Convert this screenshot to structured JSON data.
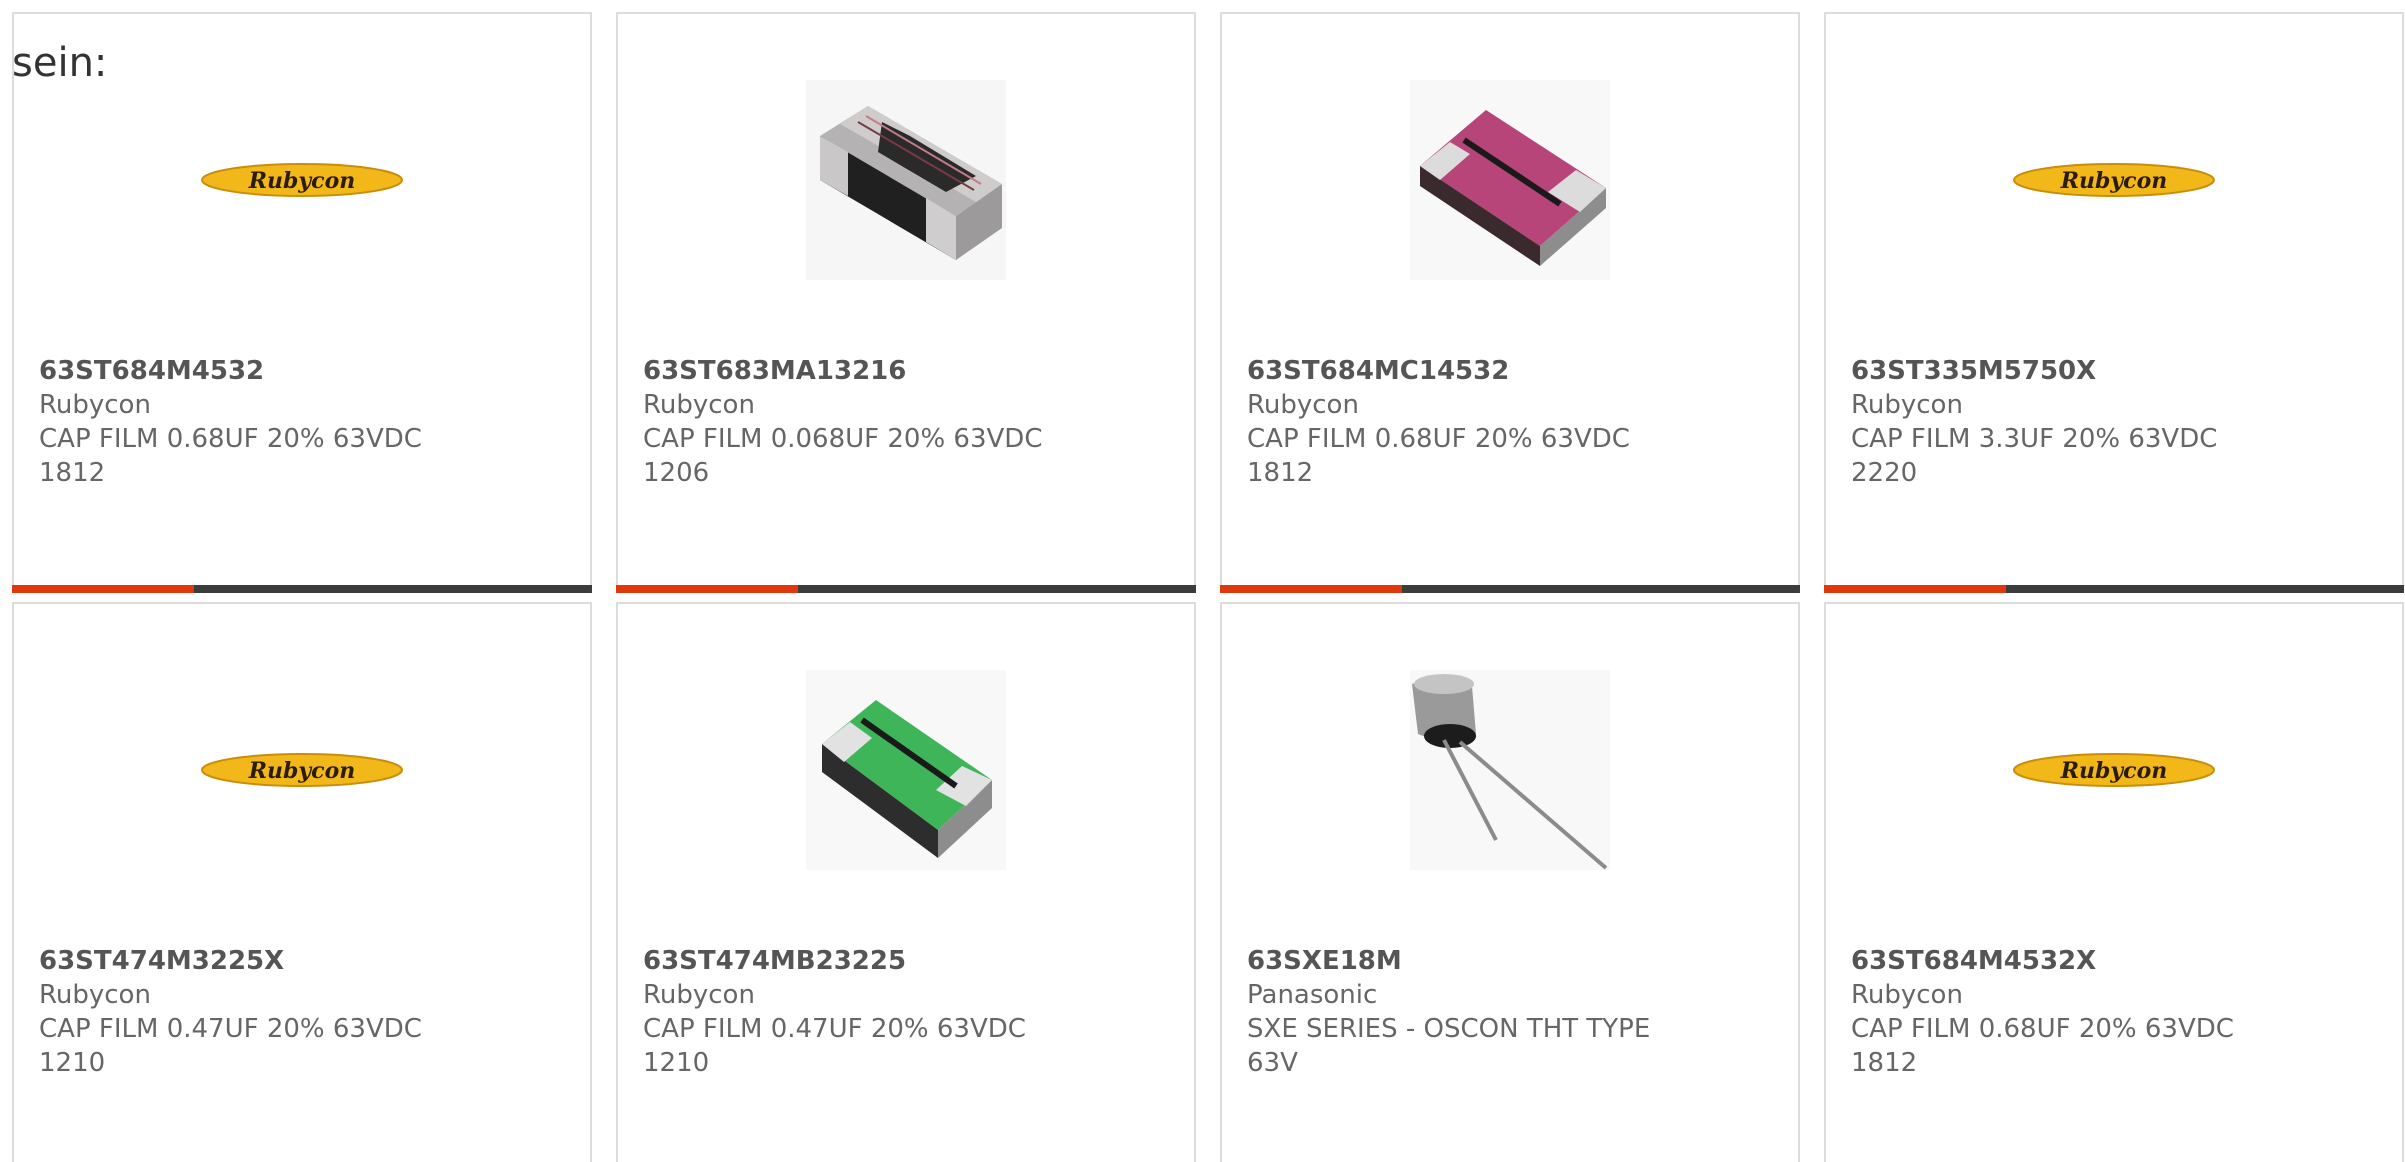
{
  "intro_text": "sein:",
  "accent_color": "#e0380d",
  "bar_color": "#3c3c3c",
  "products": [
    {
      "part": "63ST684M4532",
      "manufacturer": "Rubycon",
      "description": "CAP FILM 0.68UF 20% 63VDC",
      "package": "1812",
      "image": "rubycon-logo",
      "logo_text": "Rubycon"
    },
    {
      "part": "63ST683MA13216",
      "manufacturer": "Rubycon",
      "description": "CAP FILM 0.068UF 20% 63VDC",
      "package": "1206",
      "image": "dark-film-capacitor"
    },
    {
      "part": "63ST684MC14532",
      "manufacturer": "Rubycon",
      "description": "CAP FILM 0.68UF 20% 63VDC",
      "package": "1812",
      "image": "pink-film-capacitor"
    },
    {
      "part": "63ST335M5750X",
      "manufacturer": "Rubycon",
      "description": "CAP FILM 3.3UF 20% 63VDC",
      "package": "2220",
      "image": "rubycon-logo",
      "logo_text": "Rubycon"
    },
    {
      "part": "63ST474M3225X",
      "manufacturer": "Rubycon",
      "description": "CAP FILM 0.47UF 20% 63VDC",
      "package": "1210",
      "image": "rubycon-logo",
      "logo_text": "Rubycon"
    },
    {
      "part": "63ST474MB23225",
      "manufacturer": "Rubycon",
      "description": "CAP FILM 0.47UF 20% 63VDC",
      "package": "1210",
      "image": "green-film-capacitor"
    },
    {
      "part": "63SXE18M",
      "manufacturer": "Panasonic",
      "description": "SXE SERIES - OSCON THT TYPE",
      "package": "63V",
      "image": "radial-electrolytic-capacitor"
    },
    {
      "part": "63ST684M4532X",
      "manufacturer": "Rubycon",
      "description": "CAP FILM 0.68UF 20% 63VDC",
      "package": "1812",
      "image": "rubycon-logo",
      "logo_text": "Rubycon"
    }
  ]
}
